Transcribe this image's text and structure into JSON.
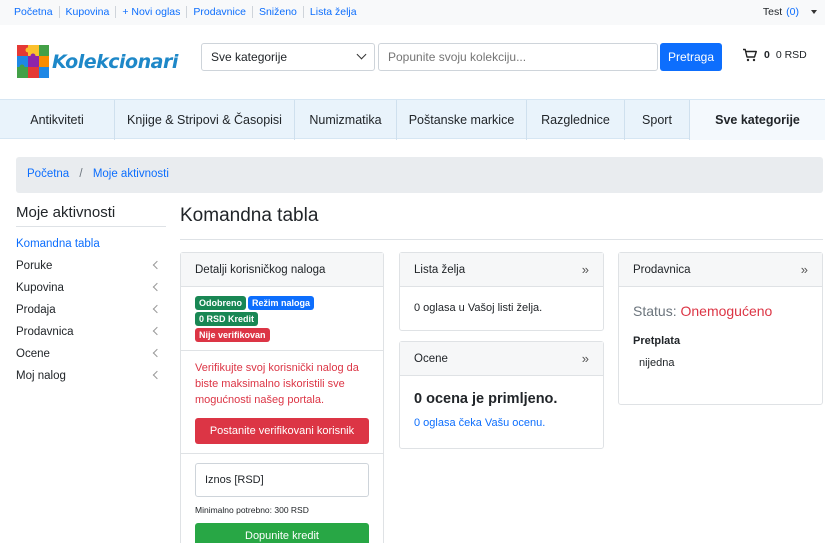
{
  "topnav": [
    "Početna",
    "Kupovina",
    "+ Novi oglas",
    "Prodavnice",
    "Sniženo",
    "Lista želja"
  ],
  "user": {
    "name": "Test",
    "count": "(0)"
  },
  "logo": {
    "text": "Kolekcionari"
  },
  "search": {
    "category": "Sve kategorije",
    "placeholder": "Popunite svoju kolekciju...",
    "button": "Pretraga"
  },
  "cart": {
    "count": "0",
    "total": "0 RSD"
  },
  "categories": [
    "Antikviteti",
    "Knjige & Stripovi & Časopisi",
    "Numizmatika",
    "Poštanske markice",
    "Razglednice",
    "Sport",
    "Sve kategorije"
  ],
  "breadcrumb": {
    "home": "Početna",
    "sep": "/",
    "current": "Moje aktivnosti"
  },
  "sidebar": {
    "title": "Moje aktivnosti",
    "items": [
      "Komandna tabla",
      "Poruke",
      "Kupovina",
      "Prodaja",
      "Prodavnica",
      "Ocene",
      "Moj nalog"
    ]
  },
  "main": {
    "title": "Komandna tabla"
  },
  "account": {
    "header": "Detalji korisničkog naloga",
    "badges": [
      "Odobreno",
      "Režim naloga",
      "0 RSD Kredit",
      "Nije verifikovan"
    ],
    "warning": "Verifikujte svoj korisnički nalog da biste maksimalno iskoristili sve mogućnosti našeg portala.",
    "verify_button": "Postanite verifikovani korisnik",
    "amount_placeholder": "Iznos [RSD]",
    "min_text": "Minimalno potrebno: 300 RSD",
    "credit_button": "Dopunite kredit"
  },
  "wishlist": {
    "header": "Lista želja",
    "arrow": "»",
    "text": "0 oglasa u Vašoj listi želja."
  },
  "ratings": {
    "header": "Ocene",
    "arrow": "»",
    "big": "0 ocena je primljeno.",
    "link": "0 oglasa čeka Vašu ocenu."
  },
  "shop": {
    "header": "Prodavnica",
    "arrow": "»",
    "status_label": "Status:",
    "status_value": "Onemogućeno",
    "plan_title": "Pretplata",
    "plan_value": "nijedna"
  },
  "colors": {
    "primary": "#0d6efd",
    "danger": "#dc3545",
    "success": "#28a745",
    "catbar": "#e9f3fb"
  }
}
